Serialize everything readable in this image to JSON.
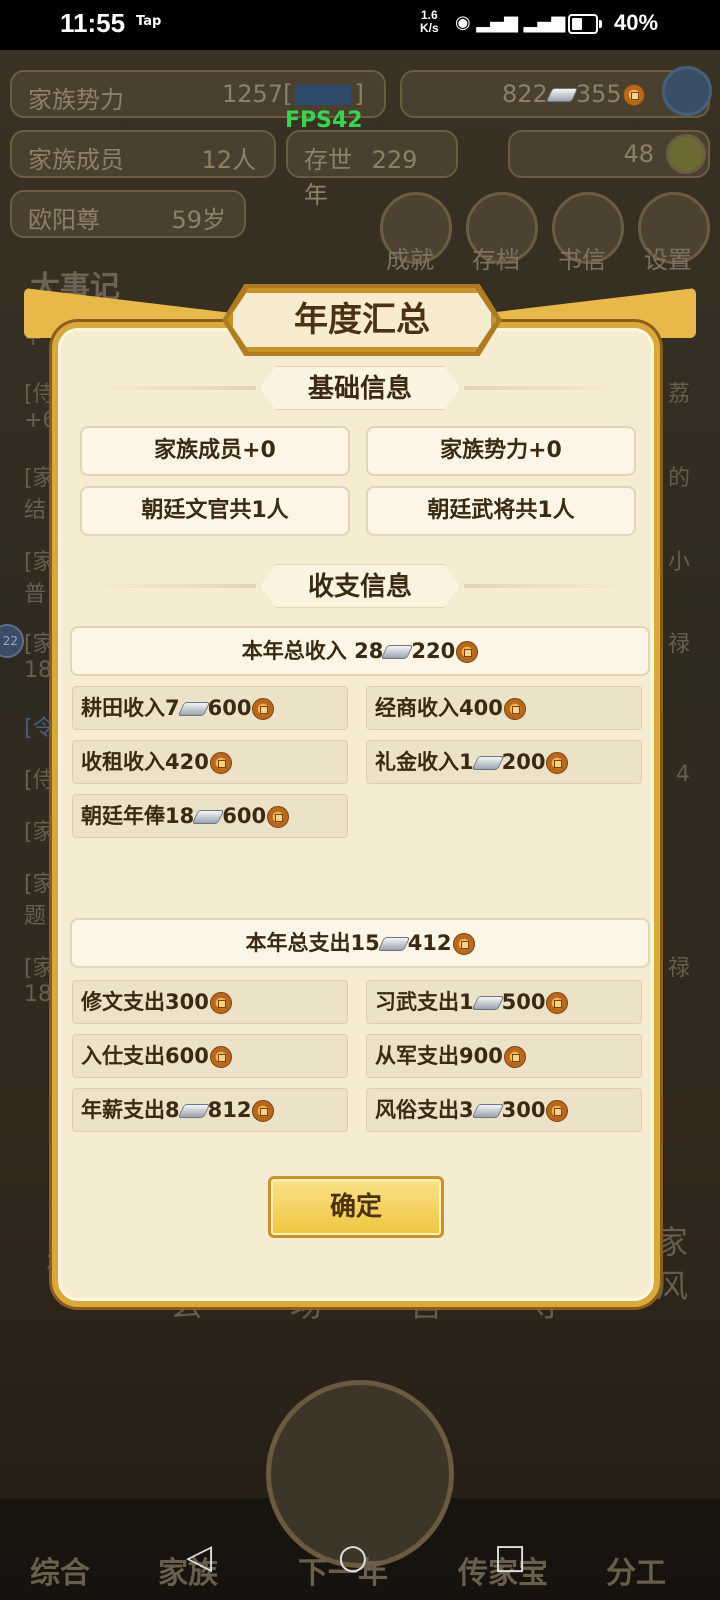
{
  "status_bar": {
    "time": "11:55",
    "carrier": "Tap",
    "speed_value": "1.6",
    "speed_unit": "K/s",
    "battery_pct": "40%",
    "battery_level": 0.4
  },
  "background": {
    "fps": "FPS42",
    "clan_power_label": "家族势力",
    "clan_power_value": "1257",
    "clan_power_suffix": "[",
    "clan_power_suffix_end": "]",
    "silver_count": "822",
    "coin_count": "355",
    "members_label": "家族成员",
    "members_value": "12人",
    "existence_label": "存世",
    "existence_value": "229年",
    "gold_value": "48",
    "patriarch_name": "欧阳尊",
    "patriarch_age": "59岁",
    "menu_items": [
      "成就",
      "存档",
      "书信",
      "设置"
    ],
    "chronicle_title": "大事记",
    "chronicle_lines": [
      "+",
      "[侍",
      "+6",
      "[家",
      "结",
      "[家",
      "普",
      "[家",
      "18",
      "[令",
      "[侍",
      "[家",
      "[家",
      "题",
      "[家",
      "18"
    ],
    "chronicle_right": [
      "荔",
      "的",
      "小",
      "禄",
      "4",
      "禄"
    ],
    "side_badge": "22",
    "building_labels": [
      "祠",
      "玄",
      "场",
      "宫",
      "寺",
      "家风"
    ],
    "nav_items": [
      "综合",
      "家族",
      "下一年",
      "传家宝",
      "分工"
    ]
  },
  "dialog": {
    "title": "年度汇总",
    "basic_section": "基础信息",
    "basic_items": [
      "家族成员+0",
      "家族势力+0",
      "朝廷文官共1人",
      "朝廷武将共1人"
    ],
    "finance_section": "收支信息",
    "income_total": {
      "label": "本年总收入",
      "silver": "28",
      "coin": "220"
    },
    "income_items": [
      {
        "label": "耕田收入",
        "silver": "7",
        "coin": "600"
      },
      {
        "label": "经商收入",
        "silver": "",
        "coin": "400"
      },
      {
        "label": "收租收入",
        "silver": "",
        "coin": "420"
      },
      {
        "label": "礼金收入",
        "silver": "1",
        "coin": "200"
      },
      {
        "label": "朝廷年俸",
        "silver": "18",
        "coin": "600"
      }
    ],
    "expense_total": {
      "label": "本年总支出",
      "silver": "15",
      "coin": "412"
    },
    "expense_items": [
      {
        "label": "修文支出",
        "silver": "",
        "coin": "300"
      },
      {
        "label": "习武支出",
        "silver": "1",
        "coin": "500"
      },
      {
        "label": "入仕支出",
        "silver": "",
        "coin": "600"
      },
      {
        "label": "从军支出",
        "silver": "",
        "coin": "900"
      },
      {
        "label": "年薪支出",
        "silver": "8",
        "coin": "812"
      },
      {
        "label": "风俗支出",
        "silver": "3",
        "coin": "300"
      }
    ],
    "confirm_label": "确定"
  },
  "colors": {
    "dialog_bg": "#f6ecd2",
    "frame_gold": "#d9a93b",
    "button_gold": "#f0c53e",
    "text_dark": "#3a2a14",
    "fps_green": "#39d34f"
  },
  "icons": {
    "silver": "silver-ingot-icon",
    "coin": "copper-coin-icon",
    "help": "help-icon",
    "add": "plus-icon"
  }
}
